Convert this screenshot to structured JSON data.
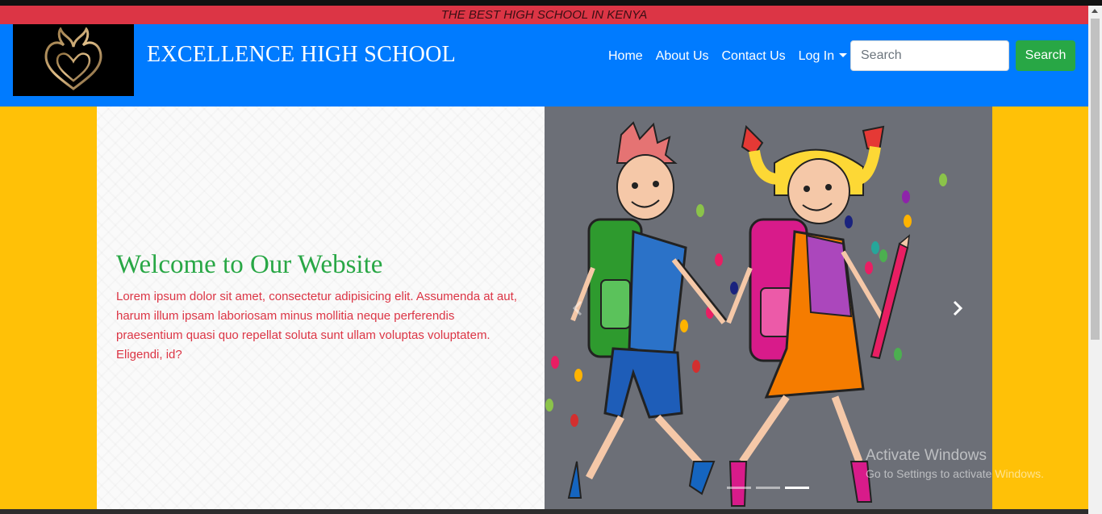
{
  "tagline": "THE BEST HIGH SCHOOL IN KENYA",
  "brand": {
    "name": "EXCELLENCE HIGH SCHOOL",
    "logo_icon": "heart-flame-icon"
  },
  "nav": {
    "items": [
      {
        "label": "Home"
      },
      {
        "label": "About Us"
      },
      {
        "label": "Contact Us"
      },
      {
        "label": "Log In"
      }
    ],
    "search_placeholder": "Search",
    "search_button": "Search"
  },
  "hero": {
    "heading": "Welcome to Our Website",
    "body": "Lorem ipsum dolor sit amet, consectetur adipisicing elit. Assumenda at aut, harum illum ipsam laboriosam minus mollitia neque perferendis praesentium quasi quo repellat soluta sunt ullam voluptas voluptatem. Eligendi, id?"
  },
  "carousel": {
    "image": "cartoon-schoolchildren-illustration",
    "prev_icon": "chevron-left-icon",
    "next_icon": "chevron-right-icon",
    "slide_count": 3,
    "active_slide": 3
  },
  "watermark": {
    "title": "Activate Windows",
    "subtitle": "Go to Settings to activate Windows."
  },
  "colors": {
    "tagline_bg": "#dc3545",
    "navbar_bg": "#007bff",
    "search_button_bg": "#28a745",
    "hero_bg": "#ffc107",
    "heading_color": "#28a745",
    "body_color": "#dc3545"
  }
}
